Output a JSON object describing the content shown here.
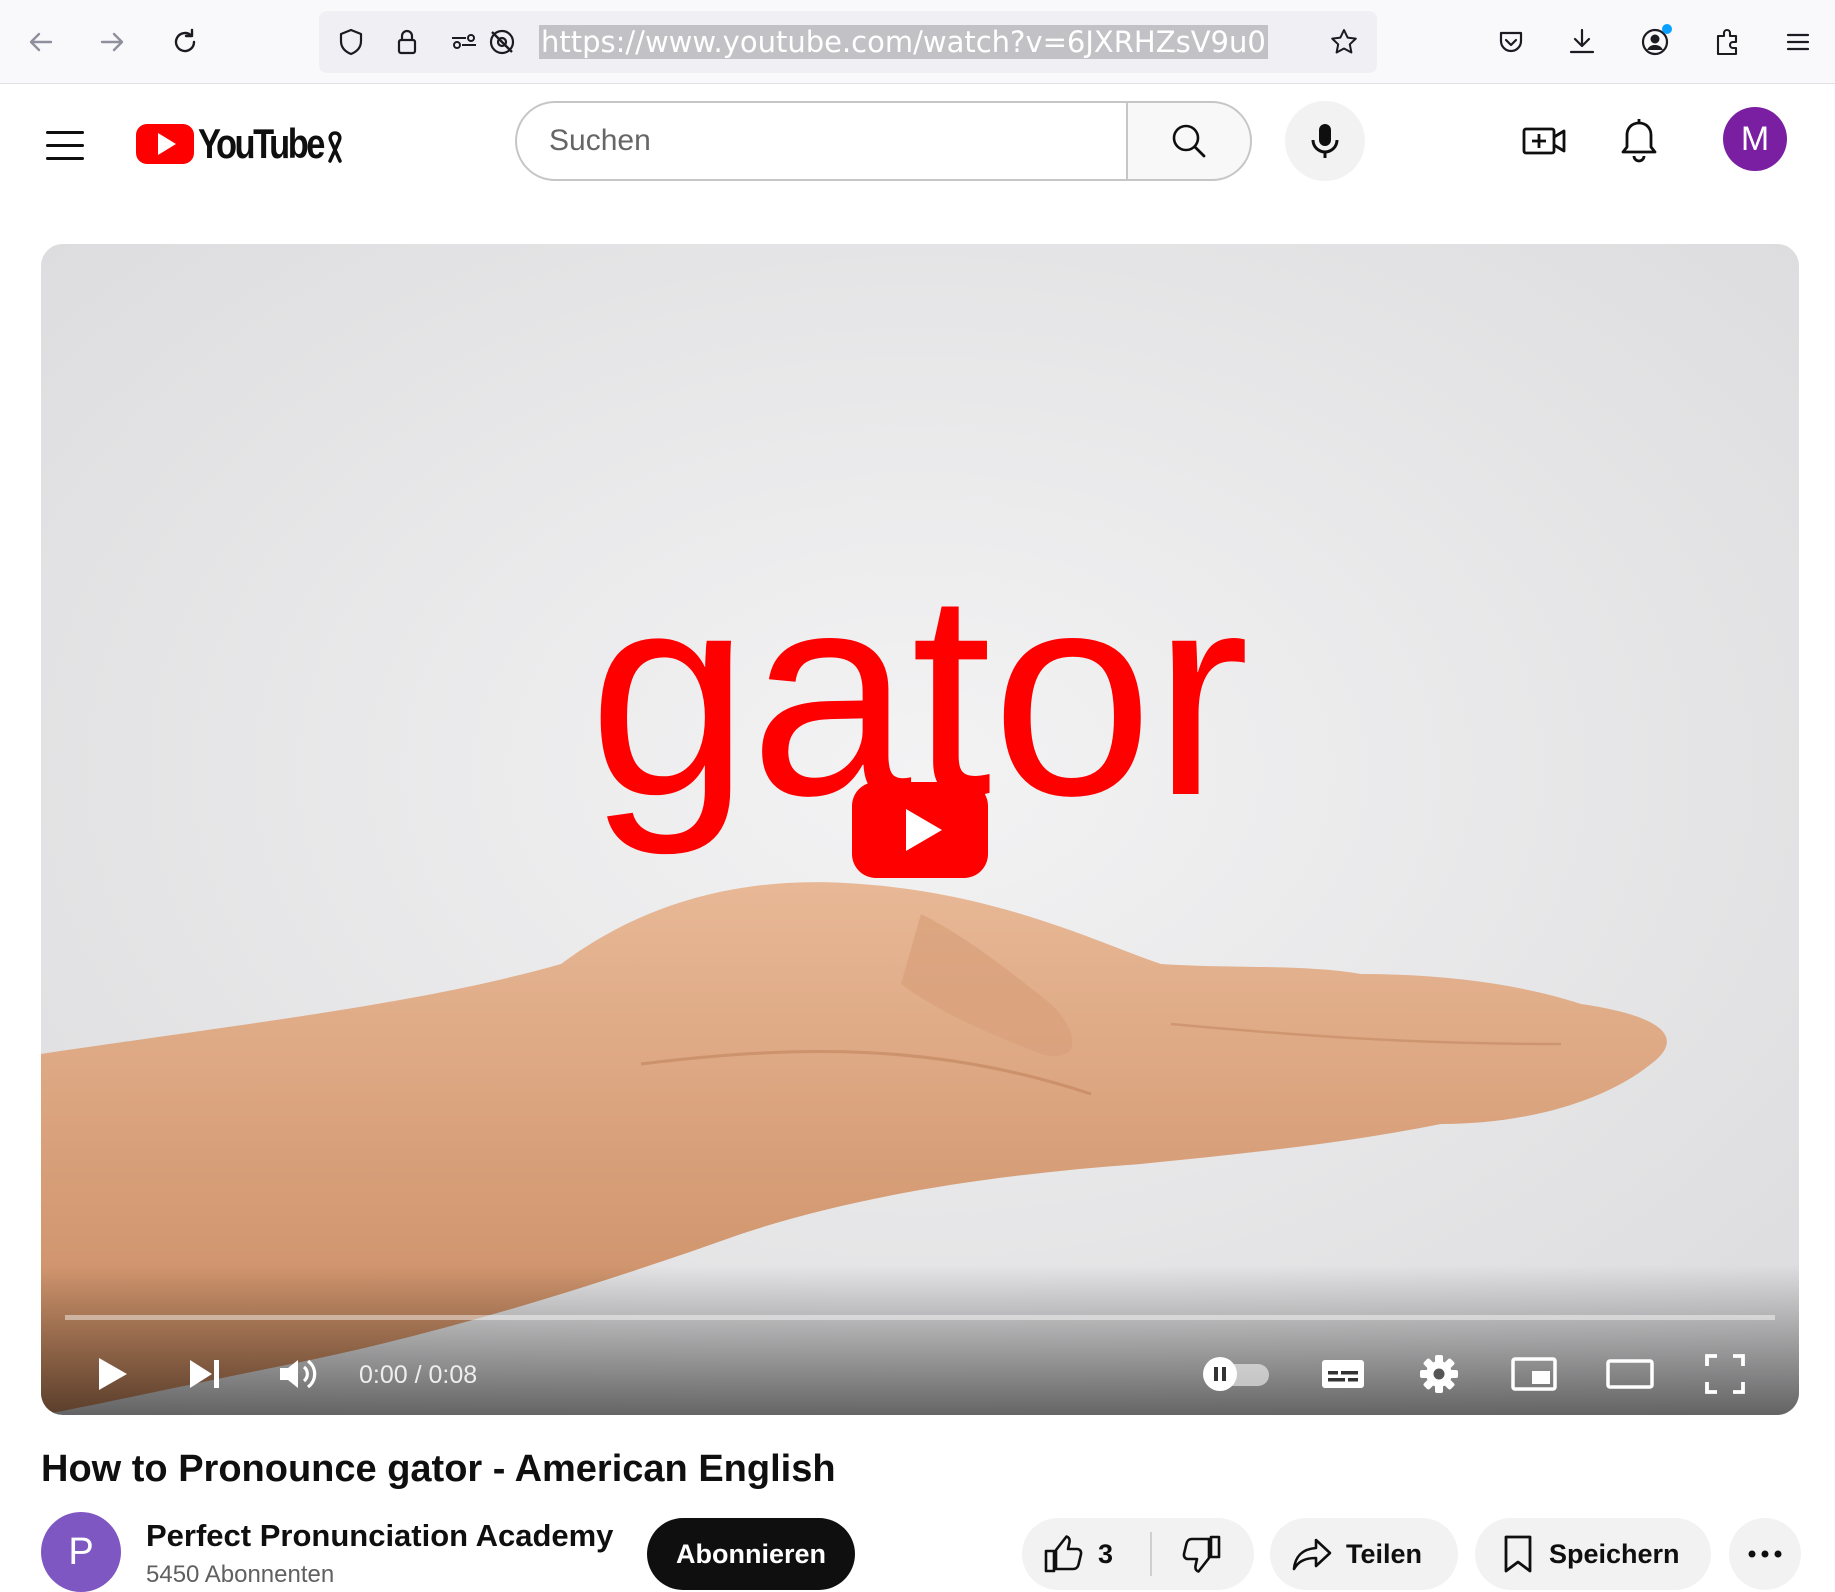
{
  "browser": {
    "url": "https://www.youtube.com/watch?v=6JXRHZsV9u0"
  },
  "youtube": {
    "logo_text": "YouTube",
    "search_placeholder": "Suchen",
    "avatar_letter": "M"
  },
  "player": {
    "overlay_word": "gator",
    "current_time": "0:00",
    "duration": "0:08",
    "time_display": "0:00 / 0:08",
    "progress": 0.0,
    "accent_color": "#ff0000"
  },
  "video": {
    "title": "How to Pronounce gator - American English",
    "channel_name": "Perfect Pronunciation Academy",
    "channel_avatar_letter": "P",
    "subscribers": "5450 Abonnenten",
    "subscribe_label": "Abonnieren",
    "like_count": "3",
    "share_label": "Teilen",
    "save_label": "Speichern"
  },
  "icons": {
    "browser": [
      "back-icon",
      "forward-icon",
      "reload-icon",
      "shield-icon",
      "lock-icon",
      "permissions-icon",
      "tracking-icon",
      "bookmark-star-icon",
      "pocket-icon",
      "download-icon",
      "account-icon",
      "extensions-icon",
      "menu-icon"
    ],
    "header": [
      "hamburger-icon",
      "search-icon",
      "mic-icon",
      "create-video-icon",
      "bell-icon"
    ],
    "player": [
      "play-icon",
      "next-icon",
      "volume-icon",
      "autoplay-toggle",
      "subtitles-icon",
      "settings-icon",
      "miniplayer-icon",
      "theater-icon",
      "fullscreen-icon"
    ],
    "actions": [
      "like-icon",
      "dislike-icon",
      "share-icon",
      "save-icon",
      "more-icon"
    ]
  }
}
